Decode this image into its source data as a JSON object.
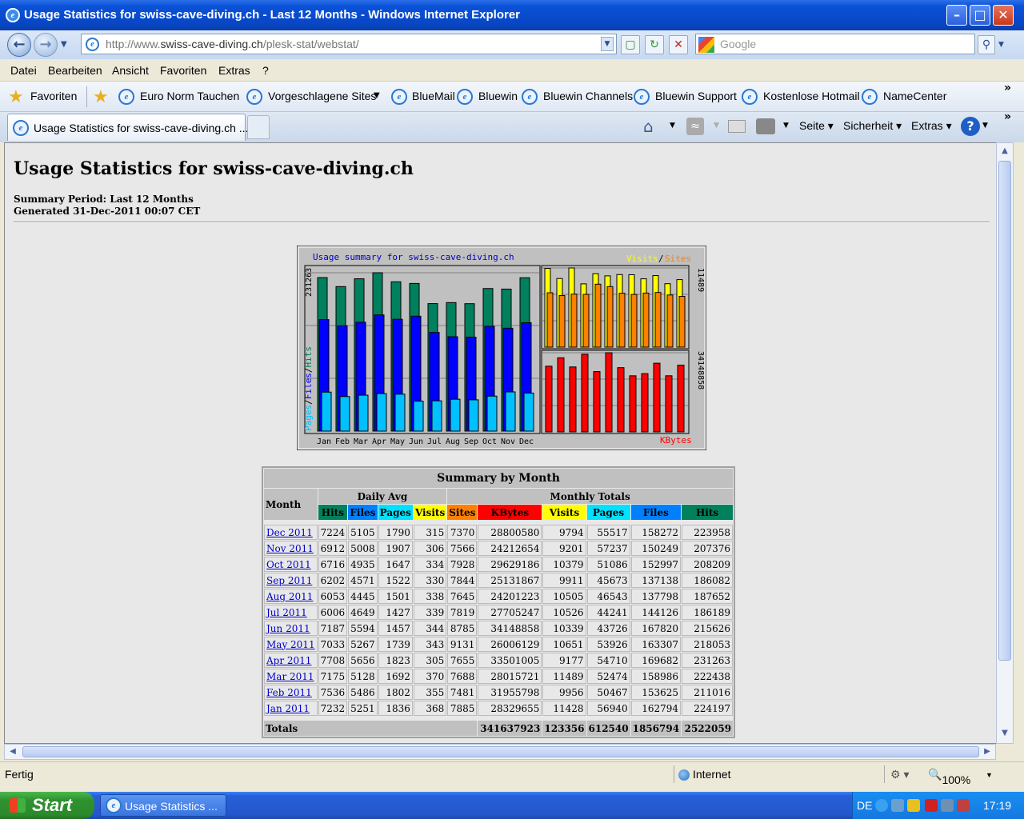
{
  "window": {
    "title": "Usage Statistics for swiss-cave-diving.ch - Last 12 Months - Windows Internet Explorer"
  },
  "address": {
    "url_prefix": "http://www.",
    "url_domain": "swiss-cave-diving.ch",
    "url_path": "/plesk-stat/webstat/",
    "search_placeholder": "Google"
  },
  "menu": [
    "Datei",
    "Bearbeiten",
    "Ansicht",
    "Favoriten",
    "Extras",
    "?"
  ],
  "favorites": {
    "label": "Favoriten",
    "links": [
      "Euro Norm Tauchen",
      "Vorgeschlagene Sites",
      "BlueMail",
      "Bluewin",
      "Bluewin Channels",
      "Bluewin Support",
      "Kostenlose Hotmail",
      "NameCenter"
    ]
  },
  "tab": {
    "label": "Usage Statistics for swiss-cave-diving.ch ..."
  },
  "tools": {
    "page": "Seite",
    "security": "Sicherheit",
    "extras": "Extras"
  },
  "page": {
    "title": "Usage Statistics for swiss-cave-diving.ch",
    "period": "Summary Period: Last 12 Months",
    "generated": "Generated 31-Dec-2011 00:07 CET"
  },
  "chart_data": {
    "type": "bar",
    "title": "Usage summary for swiss-cave-diving.ch",
    "categories": [
      "Jan",
      "Feb",
      "Mar",
      "Apr",
      "May",
      "Jun",
      "Jul",
      "Aug",
      "Sep",
      "Oct",
      "Nov",
      "Dec"
    ],
    "left_axis_label": "231263",
    "visits_axis_label": "11489",
    "kbytes_axis_label": "34148858",
    "legend_pages": "Pages",
    "legend_files": "Files",
    "legend_hits": "Hits",
    "legend_visits": "Visits",
    "legend_sites": "Sites",
    "legend_kbytes": "KBytes",
    "sep": "/",
    "series": [
      {
        "name": "Hits",
        "color": "#00805c",
        "values": [
          224197,
          211016,
          222438,
          231263,
          218053,
          215626,
          186189,
          187652,
          186082,
          208209,
          207376,
          223958
        ]
      },
      {
        "name": "Files",
        "color": "#0000ff",
        "values": [
          162794,
          153625,
          158986,
          169682,
          163307,
          167820,
          144126,
          137798,
          137138,
          152997,
          150249,
          158272
        ]
      },
      {
        "name": "Pages",
        "color": "#00c0ff",
        "values": [
          56940,
          50467,
          52474,
          54710,
          53926,
          43726,
          44241,
          46543,
          45673,
          51086,
          57237,
          55517
        ]
      },
      {
        "name": "Visits",
        "color": "#ffff00",
        "values": [
          11428,
          9956,
          11489,
          9177,
          10651,
          10339,
          10526,
          10505,
          9911,
          10379,
          9201,
          9794
        ]
      },
      {
        "name": "Sites",
        "color": "#ff8000",
        "values": [
          7885,
          7481,
          7688,
          7655,
          9131,
          8785,
          7819,
          7645,
          7844,
          7928,
          7566,
          7370
        ]
      },
      {
        "name": "KBytes",
        "color": "#ff0000",
        "values": [
          28329655,
          31955798,
          28015721,
          33501005,
          26006129,
          34148858,
          27705247,
          24201223,
          25131867,
          29629186,
          24212654,
          28800580
        ]
      }
    ]
  },
  "table": {
    "caption": "Summary by Month",
    "month_header": "Month",
    "daily_avg_header": "Daily Avg",
    "monthly_totals_header": "Monthly Totals",
    "daily_cols": [
      "Hits",
      "Files",
      "Pages",
      "Visits"
    ],
    "monthly_cols": [
      "Sites",
      "KBytes",
      "Visits",
      "Pages",
      "Files",
      "Hits"
    ],
    "rows": [
      {
        "month": "Dec 2011",
        "d_hits": "7224",
        "d_files": "5105",
        "d_pages": "1790",
        "d_visits": "315",
        "sites": "7370",
        "kbytes": "28800580",
        "visits": "9794",
        "pages": "55517",
        "files": "158272",
        "hits": "223958"
      },
      {
        "month": "Nov 2011",
        "d_hits": "6912",
        "d_files": "5008",
        "d_pages": "1907",
        "d_visits": "306",
        "sites": "7566",
        "kbytes": "24212654",
        "visits": "9201",
        "pages": "57237",
        "files": "150249",
        "hits": "207376"
      },
      {
        "month": "Oct 2011",
        "d_hits": "6716",
        "d_files": "4935",
        "d_pages": "1647",
        "d_visits": "334",
        "sites": "7928",
        "kbytes": "29629186",
        "visits": "10379",
        "pages": "51086",
        "files": "152997",
        "hits": "208209"
      },
      {
        "month": "Sep 2011",
        "d_hits": "6202",
        "d_files": "4571",
        "d_pages": "1522",
        "d_visits": "330",
        "sites": "7844",
        "kbytes": "25131867",
        "visits": "9911",
        "pages": "45673",
        "files": "137138",
        "hits": "186082"
      },
      {
        "month": "Aug 2011",
        "d_hits": "6053",
        "d_files": "4445",
        "d_pages": "1501",
        "d_visits": "338",
        "sites": "7645",
        "kbytes": "24201223",
        "visits": "10505",
        "pages": "46543",
        "files": "137798",
        "hits": "187652"
      },
      {
        "month": "Jul 2011",
        "d_hits": "6006",
        "d_files": "4649",
        "d_pages": "1427",
        "d_visits": "339",
        "sites": "7819",
        "kbytes": "27705247",
        "visits": "10526",
        "pages": "44241",
        "files": "144126",
        "hits": "186189"
      },
      {
        "month": "Jun 2011",
        "d_hits": "7187",
        "d_files": "5594",
        "d_pages": "1457",
        "d_visits": "344",
        "sites": "8785",
        "kbytes": "34148858",
        "visits": "10339",
        "pages": "43726",
        "files": "167820",
        "hits": "215626"
      },
      {
        "month": "May 2011",
        "d_hits": "7033",
        "d_files": "5267",
        "d_pages": "1739",
        "d_visits": "343",
        "sites": "9131",
        "kbytes": "26006129",
        "visits": "10651",
        "pages": "53926",
        "files": "163307",
        "hits": "218053"
      },
      {
        "month": "Apr 2011",
        "d_hits": "7708",
        "d_files": "5656",
        "d_pages": "1823",
        "d_visits": "305",
        "sites": "7655",
        "kbytes": "33501005",
        "visits": "9177",
        "pages": "54710",
        "files": "169682",
        "hits": "231263"
      },
      {
        "month": "Mar 2011",
        "d_hits": "7175",
        "d_files": "5128",
        "d_pages": "1692",
        "d_visits": "370",
        "sites": "7688",
        "kbytes": "28015721",
        "visits": "11489",
        "pages": "52474",
        "files": "158986",
        "hits": "222438"
      },
      {
        "month": "Feb 2011",
        "d_hits": "7536",
        "d_files": "5486",
        "d_pages": "1802",
        "d_visits": "355",
        "sites": "7481",
        "kbytes": "31955798",
        "visits": "9956",
        "pages": "50467",
        "files": "153625",
        "hits": "211016"
      },
      {
        "month": "Jan 2011",
        "d_hits": "7232",
        "d_files": "5251",
        "d_pages": "1836",
        "d_visits": "368",
        "sites": "7885",
        "kbytes": "28329655",
        "visits": "11428",
        "pages": "56940",
        "files": "162794",
        "hits": "224197"
      }
    ],
    "totals": {
      "label": "Totals",
      "kbytes": "341637923",
      "visits": "123356",
      "pages": "612540",
      "files": "1856794",
      "hits": "2522059"
    }
  },
  "status": {
    "text": "Fertig",
    "zone": "Internet",
    "zoom": "100%"
  },
  "taskbar": {
    "start": "Start",
    "item": "Usage Statistics ...",
    "lang": "DE",
    "clock": "17:19"
  },
  "colors": {
    "hits": "#00805c",
    "files": "#0080ff",
    "pages": "#00e0ff",
    "visits": "#ffff00",
    "sites": "#ff8000",
    "kbytes": "#ff0000"
  }
}
